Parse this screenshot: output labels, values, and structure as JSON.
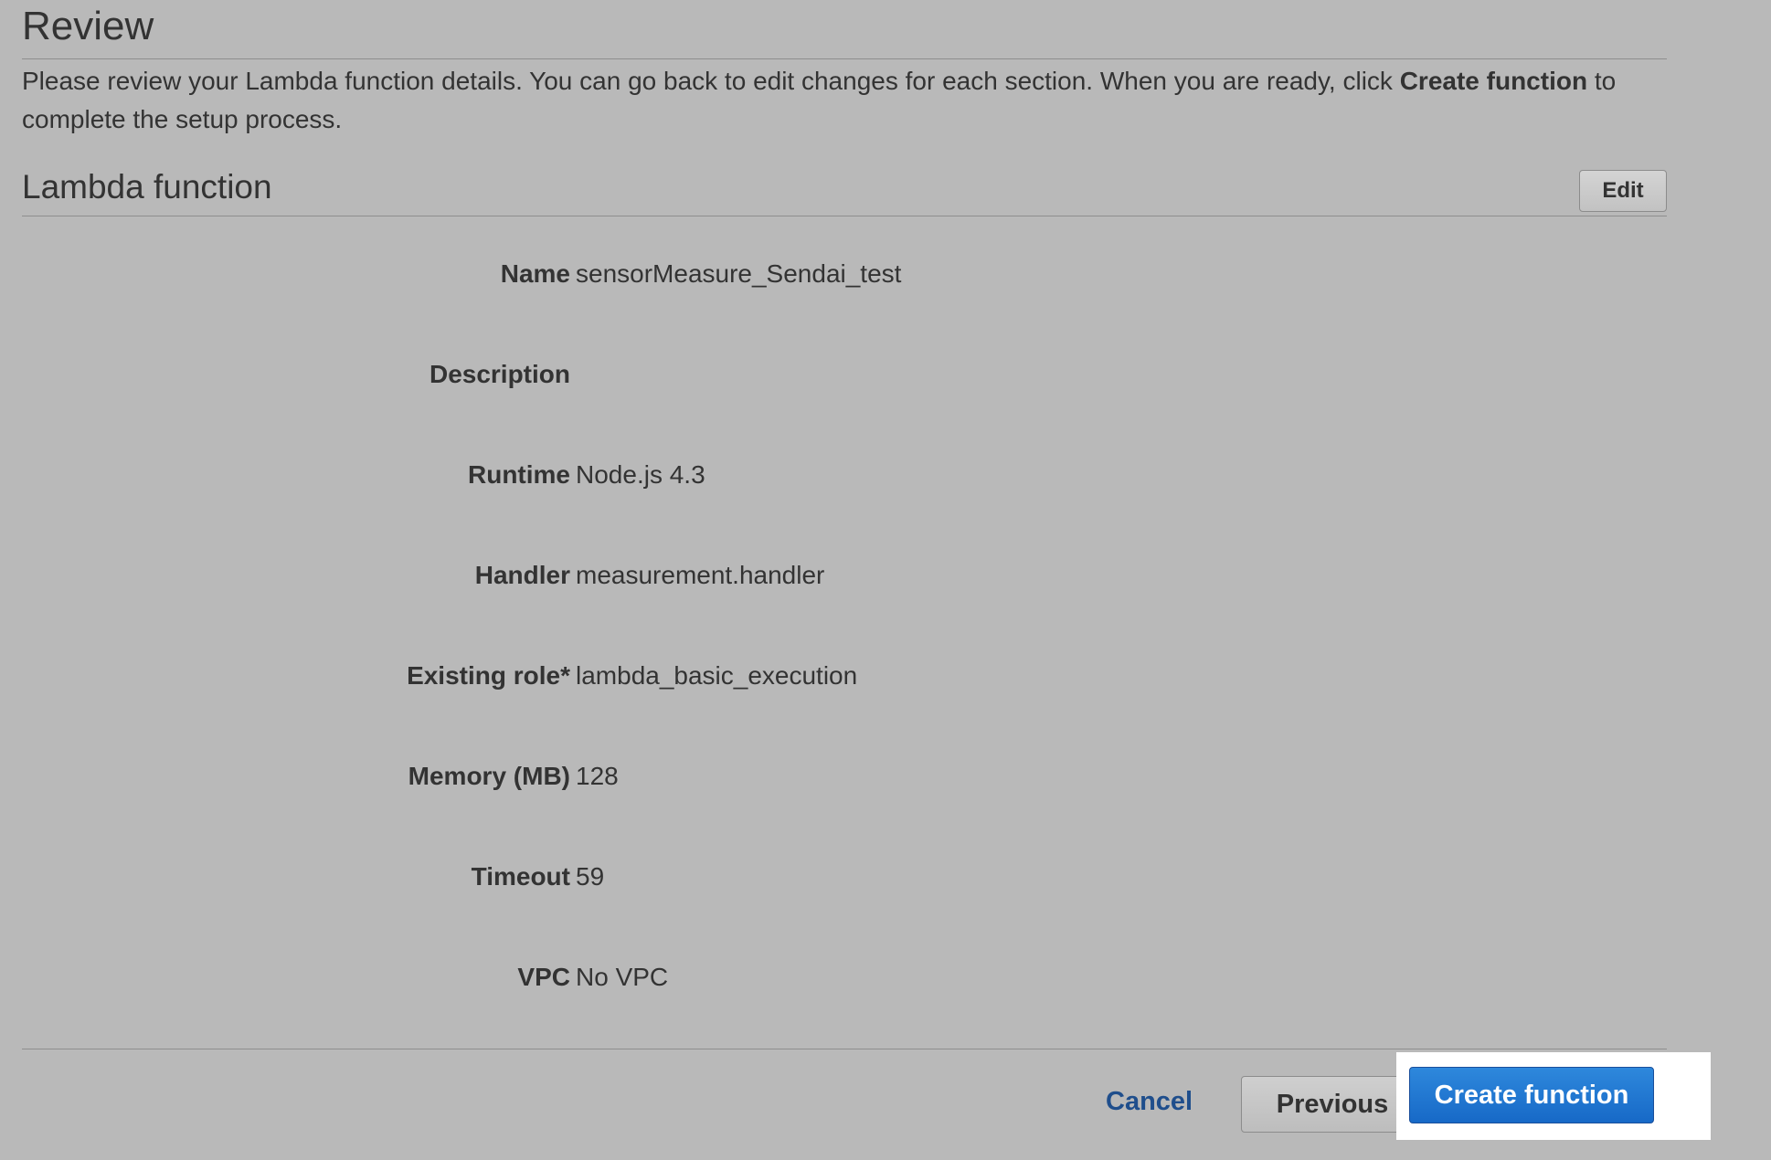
{
  "page": {
    "title": "Review",
    "intro_text_before": "Please review your Lambda function details. You can go back to edit changes for each section. When you are ready, click ",
    "intro_text_bold": "Create function",
    "intro_text_after": " to complete the setup process."
  },
  "section": {
    "title": "Lambda function",
    "edit_label": "Edit"
  },
  "details": [
    {
      "label": "Name",
      "value": "sensorMeasure_Sendai_test"
    },
    {
      "label": "Description",
      "value": ""
    },
    {
      "label": "Runtime",
      "value": "Node.js 4.3"
    },
    {
      "label": "Handler",
      "value": "measurement.handler"
    },
    {
      "label": "Existing role*",
      "value": "lambda_basic_execution"
    },
    {
      "label": "Memory (MB)",
      "value": "128"
    },
    {
      "label": "Timeout",
      "value": "59"
    },
    {
      "label": "VPC",
      "value": "No VPC"
    }
  ],
  "footer": {
    "cancel_label": "Cancel",
    "previous_label": "Previous",
    "create_label": "Create function"
  },
  "colors": {
    "background": "#b9b9b9",
    "text": "#333333",
    "link": "#1f4e8c",
    "primary_button": "#1769c7",
    "highlight": "#ffffff"
  }
}
